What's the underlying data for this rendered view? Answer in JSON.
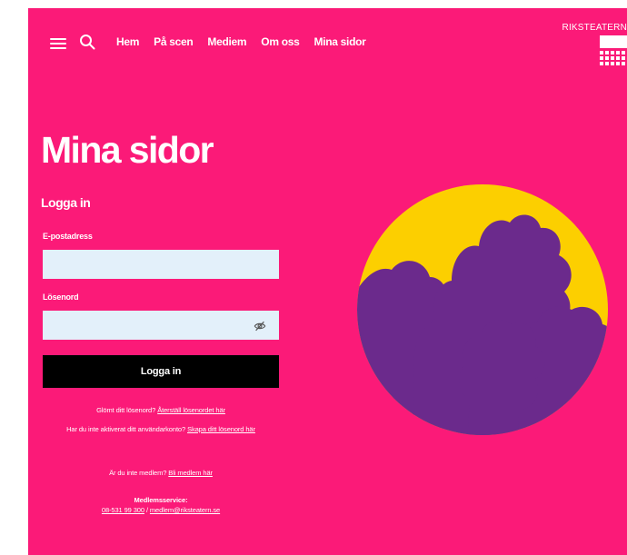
{
  "nav": {
    "items": [
      "Hem",
      "På scen",
      "Mediem",
      "Om oss",
      "Mina sidor"
    ]
  },
  "logo": {
    "text": "RIKSTEATERN"
  },
  "page": {
    "title": "Mina sidor",
    "subtitle": "Logga in"
  },
  "form": {
    "email_label": "E-postadress",
    "email_value": "",
    "password_label": "Lösenord",
    "password_value": "",
    "submit_label": "Logga in"
  },
  "help": {
    "forgot_text": "Glömt ditt lösenord?",
    "forgot_link": "Återställ lösenordet här",
    "activate_text": "Har du inte aktiverat ditt användarkonto?",
    "activate_link": "Skapa ditt lösenord här",
    "member_text": "Är du inte medlem?",
    "member_link": "Bli medlem här",
    "service_title": "Medlemsservice:",
    "service_phone": "08-531 99 300",
    "service_sep": "/",
    "service_email": "medlem@riksteatern.se"
  },
  "colors": {
    "background": "#fb1a78",
    "input_bg": "#e3f0fa",
    "button_bg": "#000000",
    "sun": "#fccf00",
    "silhouette": "#6b2a8c"
  },
  "icons": [
    "menu-icon",
    "search-icon",
    "eye-off-icon",
    "riksteatern-logo"
  ]
}
